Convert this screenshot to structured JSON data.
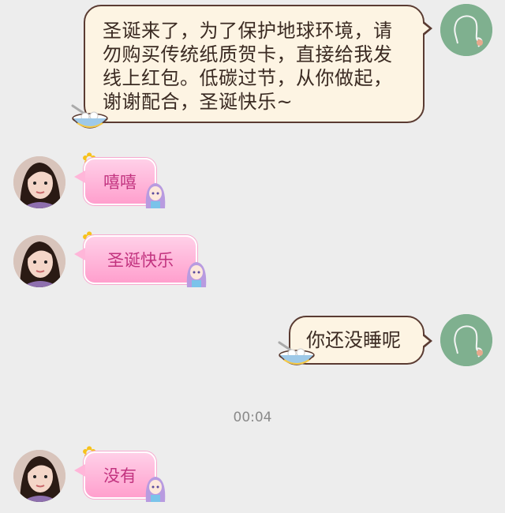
{
  "messages": [
    {
      "side": "right",
      "text": "圣诞来了，为了保护地球环境，请勿购买传统纸质贺卡，直接给我发线上红包。低碳过节，从你做起，谢谢配合，圣诞快乐~"
    },
    {
      "side": "left",
      "text": "嘻嘻"
    },
    {
      "side": "left",
      "text": "圣诞快乐"
    },
    {
      "side": "right",
      "text": "你还没睡呢"
    },
    {
      "side": "left",
      "text": "没有"
    }
  ],
  "timestamp": "00:04",
  "colors": {
    "background": "#ededed",
    "outgoing_bubble": "#fdf4e3",
    "outgoing_border": "#5a3b32",
    "incoming_bubble": "#ff9fcd",
    "incoming_text": "#c2337f",
    "self_avatar": "#7fb08f"
  },
  "icons": {
    "self_avatar": "silhouette-avatar-icon",
    "bowl": "tangyuan-bowl-icon",
    "flower": "flower-icon",
    "doll": "anime-girl-sticker-icon"
  }
}
